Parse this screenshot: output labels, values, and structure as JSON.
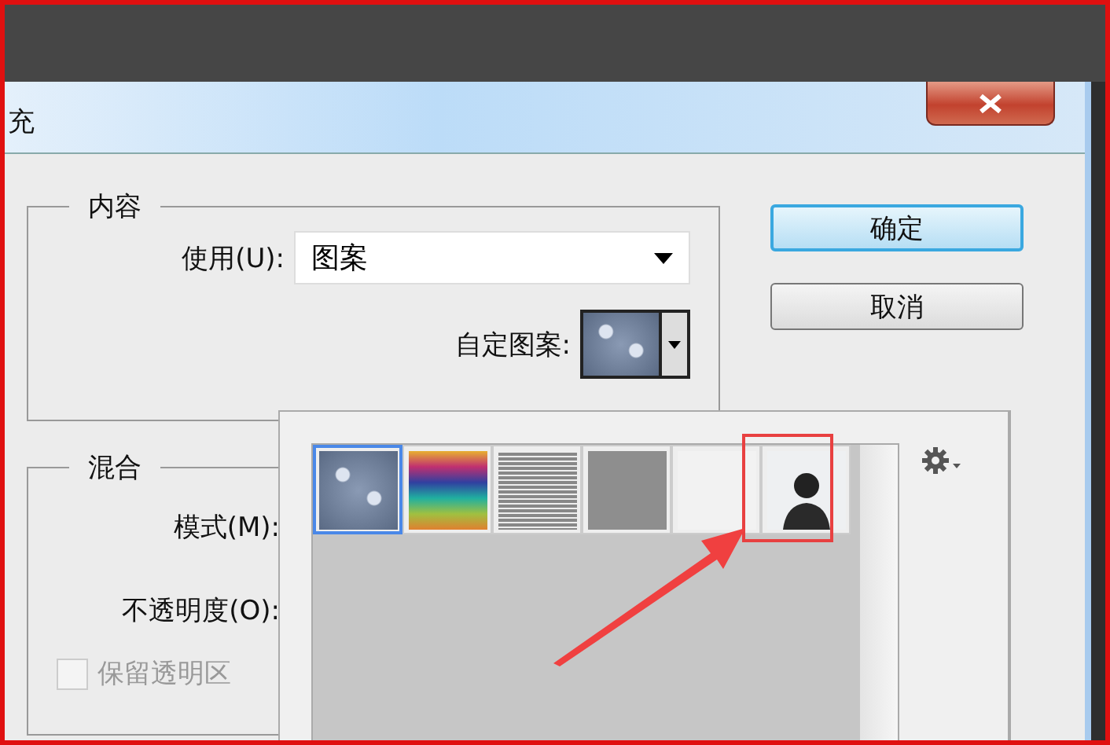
{
  "window": {
    "title": "充"
  },
  "content": {
    "legend": "内容",
    "use_label": "使用(U):",
    "use_value": "图案",
    "custom_pattern_label": "自定图案:"
  },
  "buttons": [
    {
      "label": "确定",
      "kind": "default"
    },
    {
      "label": "取消",
      "kind": "normal"
    }
  ],
  "blending": {
    "legend": "混合",
    "mode_label": "模式(M):",
    "opacity_label": "不透明度(O):",
    "preserve": {
      "label": "保留透明区",
      "checked": false,
      "disabled": true
    }
  },
  "pattern_picker": {
    "swatches": [
      {
        "kind": "bubbles",
        "selected": true
      },
      {
        "kind": "rainbow",
        "selected": false
      },
      {
        "kind": "lines",
        "selected": false
      },
      {
        "kind": "noise",
        "selected": false
      },
      {
        "kind": "paper",
        "selected": false
      },
      {
        "kind": "photo",
        "selected": false
      }
    ]
  }
}
